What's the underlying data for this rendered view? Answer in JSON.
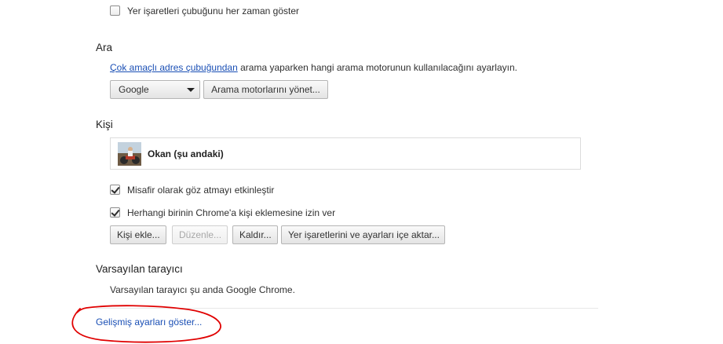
{
  "top": {
    "bookmarks_bar_label": "Yer işaretleri çubuğunu her zaman göster",
    "bookmarks_bar_checked": false
  },
  "search": {
    "title": "Ara",
    "link_text": "Çok amaçlı adres çubuğundan",
    "description": " arama yaparken hangi arama motorunun kullanılacağını ayarlayın.",
    "engine_selected": "Google",
    "manage_button": "Arama motorlarını yönet..."
  },
  "people": {
    "title": "Kişi",
    "profile_name": "Okan (şu andaki)",
    "guest_label": "Misafir olarak göz atmayı etkinleştir",
    "guest_checked": true,
    "add_person_label": "Herhangi birinin Chrome'a kişi eklemesine izin ver",
    "add_person_checked": true,
    "buttons": {
      "add": "Kişi ekle...",
      "edit": "Düzenle...",
      "remove": "Kaldır...",
      "import": "Yer işaretlerini ve ayarları içe aktar..."
    }
  },
  "default_browser": {
    "title": "Varsayılan tarayıcı",
    "status": "Varsayılan tarayıcı şu anda Google Chrome."
  },
  "advanced_link": "Gelişmiş ayarları göster...",
  "colors": {
    "link": "#1a4fb5",
    "annotation": "#e00000"
  }
}
